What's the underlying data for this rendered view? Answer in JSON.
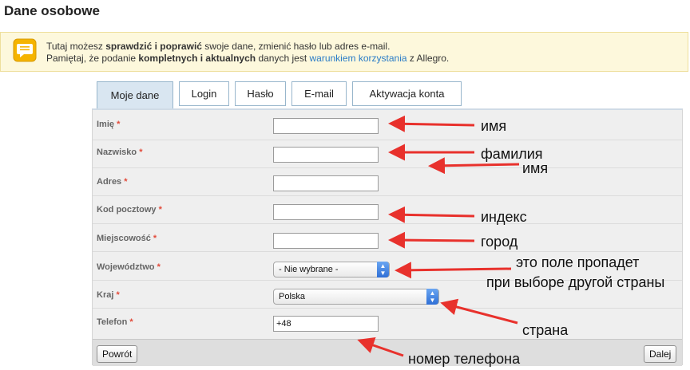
{
  "page_title": "Dane osobowe",
  "info": {
    "line1_pre": "Tutaj możesz ",
    "line1_bold": "sprawdzić i poprawić",
    "line1_post": " swoje dane, zmienić hasło lub adres e-mail.",
    "line2_pre": "Pamiętaj, że podanie ",
    "line2_bold": "kompletnych i aktualnych",
    "line2_mid": " danych jest ",
    "line2_link": "warunkiem korzystania",
    "line2_post": " z Allegro."
  },
  "tabs": [
    {
      "label": "Moje dane",
      "active": true
    },
    {
      "label": "Login",
      "active": false
    },
    {
      "label": "Hasło",
      "active": false
    },
    {
      "label": "E-mail",
      "active": false
    },
    {
      "label": "Aktywacja konta",
      "active": false
    }
  ],
  "form": {
    "required_mark": "*",
    "fields": [
      {
        "label": "Imię",
        "value": ""
      },
      {
        "label": "Nazwisko",
        "value": ""
      },
      {
        "label": "Adres",
        "value": ""
      },
      {
        "label": "Kod pocztowy",
        "value": ""
      },
      {
        "label": "Miejscowość",
        "value": ""
      },
      {
        "label": "Województwo",
        "value": "- Nie wybrane -"
      },
      {
        "label": "Kraj",
        "value": "Polska"
      },
      {
        "label": "Telefon",
        "value": "+48"
      }
    ],
    "back_button": "Powrót",
    "next_button": "Dalej"
  },
  "annotations": {
    "first_name": "имя",
    "last_name": "фамилия",
    "address": "имя",
    "postal_code": "индекс",
    "city": "город",
    "region_line1": "это поле пропадет",
    "region_line2": "при выборе другой страны",
    "country": "страна",
    "phone": "номер телефона"
  },
  "colors": {
    "link": "#2a7cc7",
    "required": "#e24a3a",
    "arrow": "#e8312c",
    "active_tab": "#d9e6f1"
  }
}
